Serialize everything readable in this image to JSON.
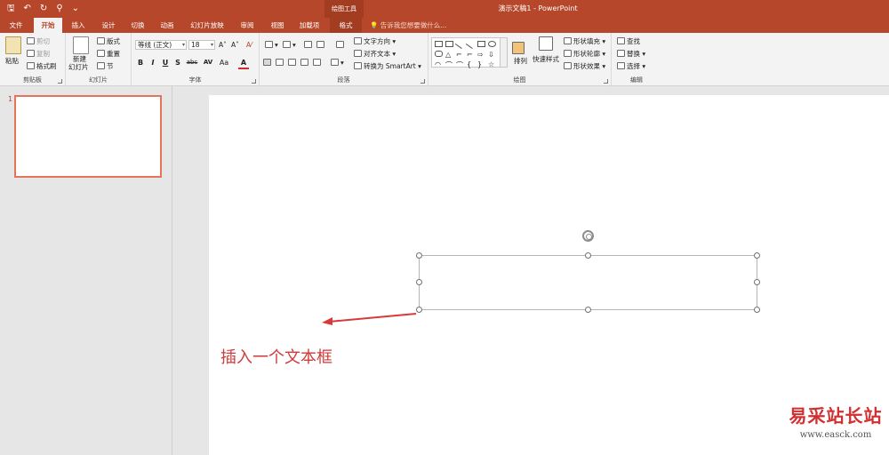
{
  "titlebar": {
    "qat": [
      "🖫",
      "↶",
      "↻",
      "⚲",
      "⌄"
    ],
    "context_tools": "绘图工具",
    "doc_title": "演示文稿1 - PowerPoint"
  },
  "tabs": [
    "文件",
    "开始",
    "插入",
    "设计",
    "切换",
    "动画",
    "幻灯片放映",
    "审阅",
    "视图",
    "加载项",
    "格式"
  ],
  "tell_me": "告诉我您想要做什么...",
  "ribbon": {
    "clipboard": {
      "label": "剪贴板",
      "paste": "粘贴",
      "cut": "剪切",
      "copy": "复制",
      "format_painter": "格式刷"
    },
    "slides": {
      "label": "幻灯片",
      "new_slide": "新建",
      "new_slide2": "幻灯片",
      "layout": "版式",
      "reset": "重置",
      "section": "节"
    },
    "font": {
      "label": "字体",
      "font_name": "等线 (正文)",
      "font_size": "18",
      "grow": "A˄",
      "shrink": "A˅",
      "clear": "A⁄",
      "bold": "B",
      "italic": "I",
      "underline": "U",
      "shadow": "S",
      "strike": "abc",
      "spacing": "AV",
      "case": "Aa",
      "color": "A"
    },
    "paragraph": {
      "label": "段落",
      "text_direction": "文字方向",
      "align_text": "对齐文本",
      "smartart": "转换为 SmartArt"
    },
    "drawing": {
      "label": "绘图",
      "arrange": "排列",
      "quick_styles": "快速样式",
      "fill": "形状填充",
      "outline": "形状轮廓",
      "effects": "形状效果"
    },
    "editing": {
      "label": "编辑",
      "find": "查找",
      "replace": "替换",
      "select": "选择"
    }
  },
  "slides_pane": {
    "slide_number": "1"
  },
  "annotation": "插入一个文本框",
  "watermark": {
    "cn": "易采站长站",
    "url": "www.easck.com"
  }
}
